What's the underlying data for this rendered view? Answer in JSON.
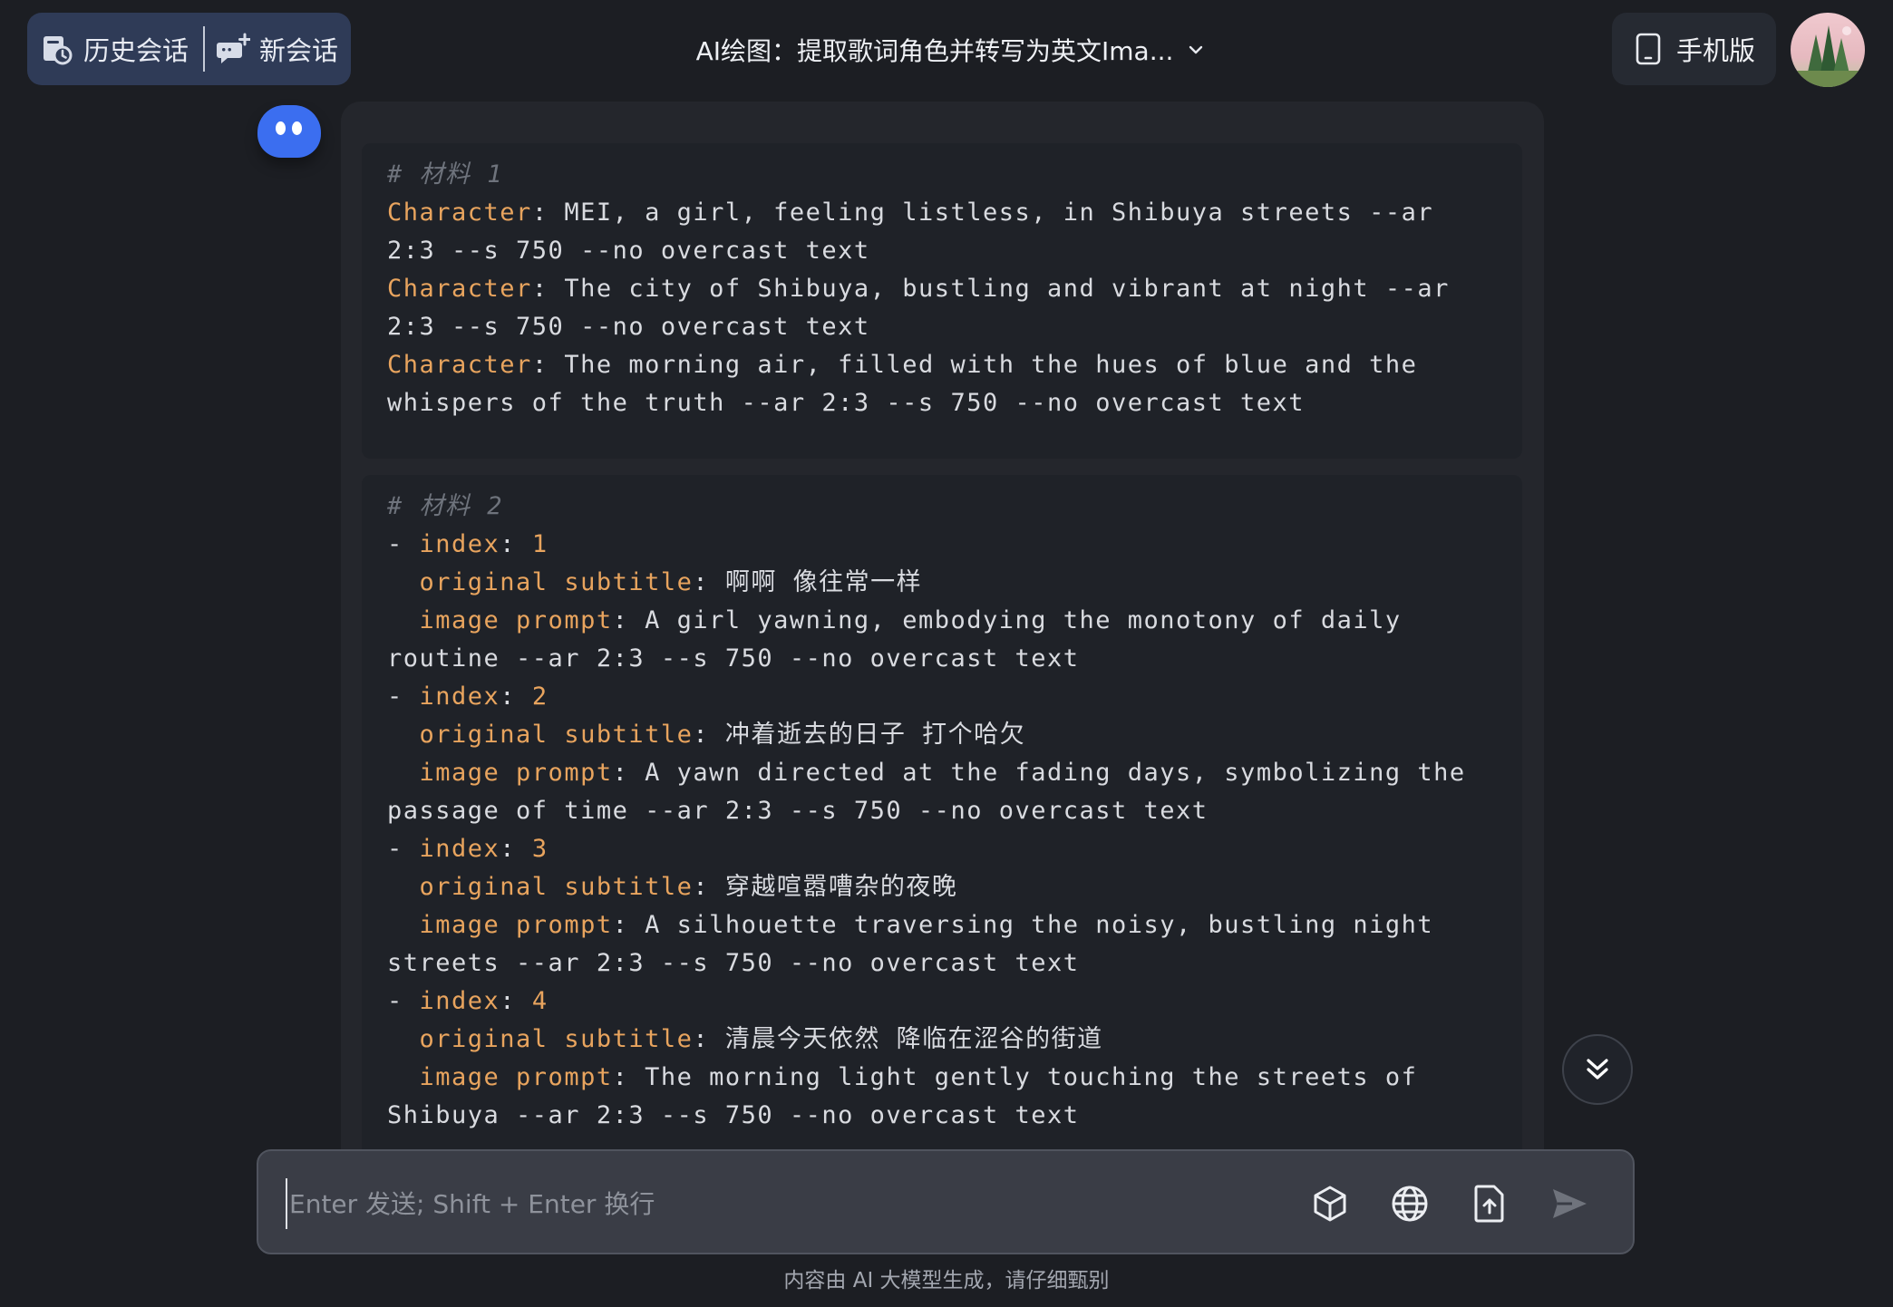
{
  "header": {
    "history_label": "历史会话",
    "new_chat_label": "新会话",
    "conversation_title": "AI绘图：提取歌词角色并转写为英文Ima...",
    "mobile_label": "手机版"
  },
  "message": {
    "block1": {
      "comment": "# 材料 1",
      "lines": [
        {
          "key": "Character",
          "sep": ": ",
          "text": "MEI, a girl, feeling listless, in Shibuya streets --ar"
        },
        {
          "text": "2:3 --s 750 --no overcast text"
        },
        {
          "key": "Character",
          "sep": ": ",
          "text": "The city of Shibuya, bustling and vibrant at night --ar"
        },
        {
          "text": "2:3 --s 750 --no overcast text"
        },
        {
          "key": "Character",
          "sep": ": ",
          "text": "The morning air, filled with the hues of blue and the"
        },
        {
          "text": "whispers of the truth --ar 2:3 --s 750 --no overcast text"
        }
      ]
    },
    "block2": {
      "comment": "# 材料 2",
      "lines": [
        {
          "pre": "- ",
          "key": "index",
          "sep": ": ",
          "num": "1"
        },
        {
          "pre": "  ",
          "key": "original subtitle",
          "sep": ": ",
          "text": "啊啊 像往常一样"
        },
        {
          "pre": "  ",
          "key": "image prompt",
          "sep": ": ",
          "text": "A girl yawning, embodying the monotony of daily"
        },
        {
          "text": "routine --ar 2:3 --s 750 --no overcast text"
        },
        {
          "pre": "- ",
          "key": "index",
          "sep": ": ",
          "num": "2"
        },
        {
          "pre": "  ",
          "key": "original subtitle",
          "sep": ": ",
          "text": "冲着逝去的日子 打个哈欠"
        },
        {
          "pre": "  ",
          "key": "image prompt",
          "sep": ": ",
          "text": "A yawn directed at the fading days, symbolizing the"
        },
        {
          "text": "passage of time --ar 2:3 --s 750 --no overcast text"
        },
        {
          "pre": "- ",
          "key": "index",
          "sep": ": ",
          "num": "3"
        },
        {
          "pre": "  ",
          "key": "original subtitle",
          "sep": ": ",
          "text": "穿越喧嚣嘈杂的夜晚"
        },
        {
          "pre": "  ",
          "key": "image prompt",
          "sep": ": ",
          "text": "A silhouette traversing the noisy, bustling night"
        },
        {
          "text": "streets --ar 2:3 --s 750 --no overcast text"
        },
        {
          "pre": "- ",
          "key": "index",
          "sep": ": ",
          "num": "4"
        },
        {
          "pre": "  ",
          "key": "original subtitle",
          "sep": ": ",
          "text": "清晨今天依然 降临在涩谷的街道"
        },
        {
          "pre": "  ",
          "key": "image prompt",
          "sep": ": ",
          "text": "The morning light gently touching the streets of"
        },
        {
          "text": "Shibuya --ar 2:3 --s 750 --no overcast text"
        }
      ]
    }
  },
  "composer": {
    "placeholder": "Enter 发送; Shift + Enter 换行"
  },
  "footer": {
    "note": "内容由 AI 大模型生成，请仔细甄别"
  },
  "colors": {
    "background": "#1c1e23",
    "key_orange": "#e8a45e",
    "comment_gray": "#6e737c",
    "accent_blue": "#3b6ef0"
  },
  "icons": [
    "history-icon",
    "new-chat-icon",
    "chevron-down-icon",
    "mobile-icon",
    "cube-icon",
    "globe-icon",
    "upload-file-icon",
    "send-icon",
    "double-chevron-down-icon"
  ]
}
